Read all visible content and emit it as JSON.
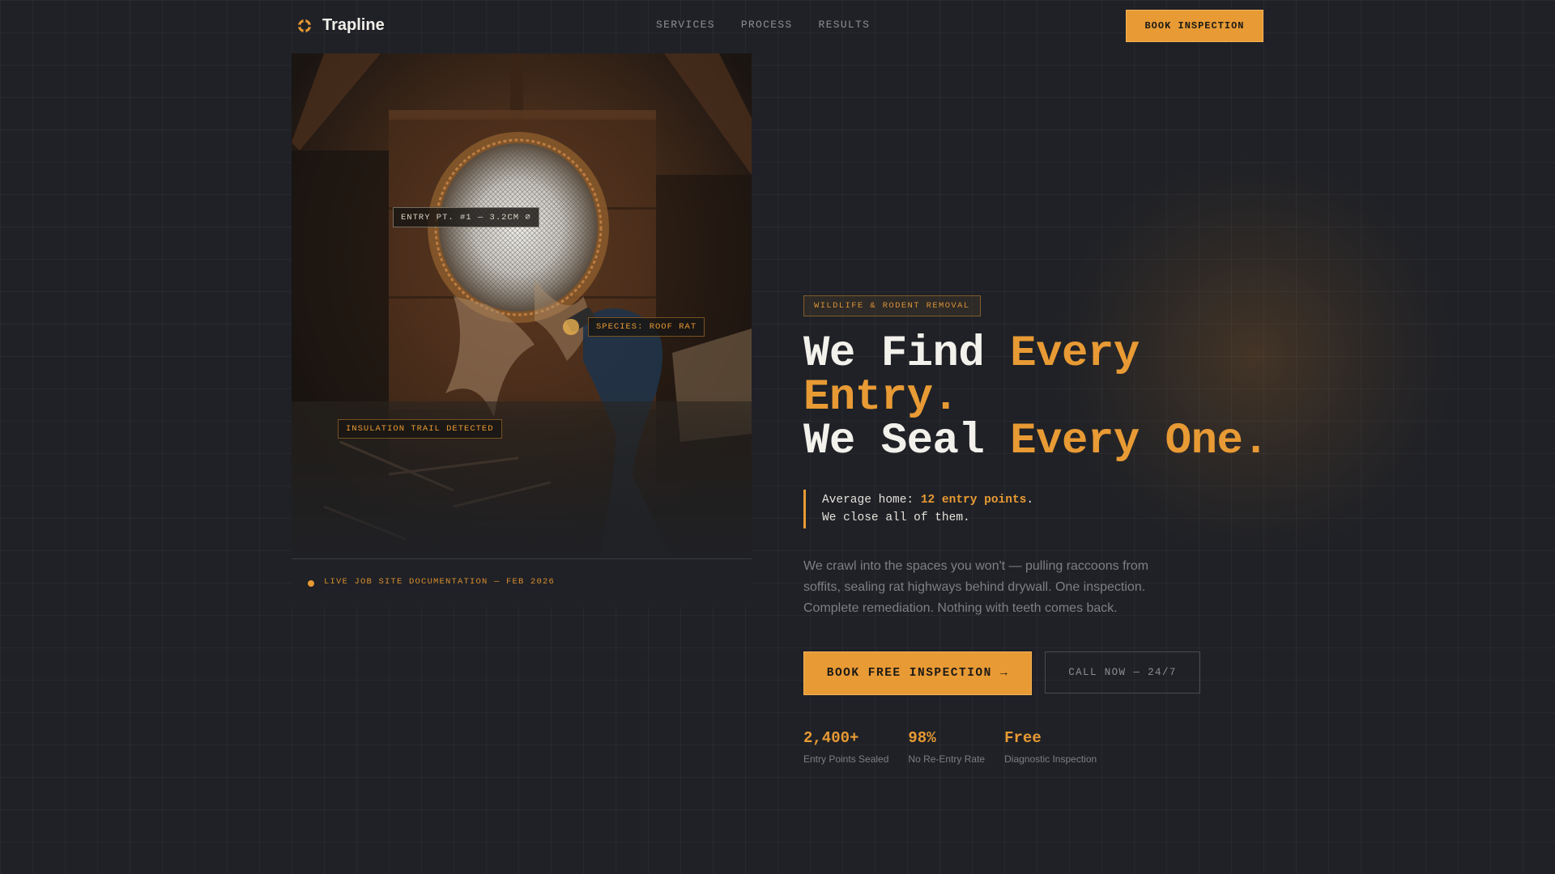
{
  "brand": {
    "name": "Trapline",
    "icon": "ring-logo-icon"
  },
  "nav": {
    "links": [
      "SERVICES",
      "PROCESS",
      "RESULTS"
    ],
    "cta_label": "BOOK INSPECTION"
  },
  "photo": {
    "tags": {
      "entry": "ENTRY PT. #1 — 3.2CM ∅",
      "species": "SPECIES: ROOF RAT",
      "trail": "INSULATION TRAIL DETECTED"
    },
    "footer_text": "LIVE JOB SITE DOCUMENTATION — FEB 2026"
  },
  "hero": {
    "badge": "WILDLIFE & RODENT REMOVAL",
    "headline": {
      "line1_white": "We Find ",
      "line1_accent": "Every",
      "line2_accent": "Entry.",
      "line3_white": "We Seal ",
      "line3_accent": "Every One."
    },
    "quote": {
      "prefix": "Average home: ",
      "highlight": "12 entry points",
      "suffix": ".",
      "line2": "We close all of them."
    },
    "description": "We crawl into the spaces you won't — pulling raccoons from soffits, sealing rat highways behind drywall. One inspection. Complete remediation. Nothing with teeth comes back.",
    "cta_primary": "BOOK FREE INSPECTION →",
    "cta_secondary": "CALL NOW — 24/7",
    "stats": [
      {
        "value": "2,400+",
        "label": "Entry Points Sealed"
      },
      {
        "value": "98%",
        "label": "No Re-Entry Rate"
      },
      {
        "value": "Free",
        "label": "Diagnostic Inspection"
      }
    ]
  },
  "colors": {
    "accent": "#e89a34",
    "background": "#1f2126",
    "text": "#f3f1ec",
    "muted": "#7e7f82"
  }
}
